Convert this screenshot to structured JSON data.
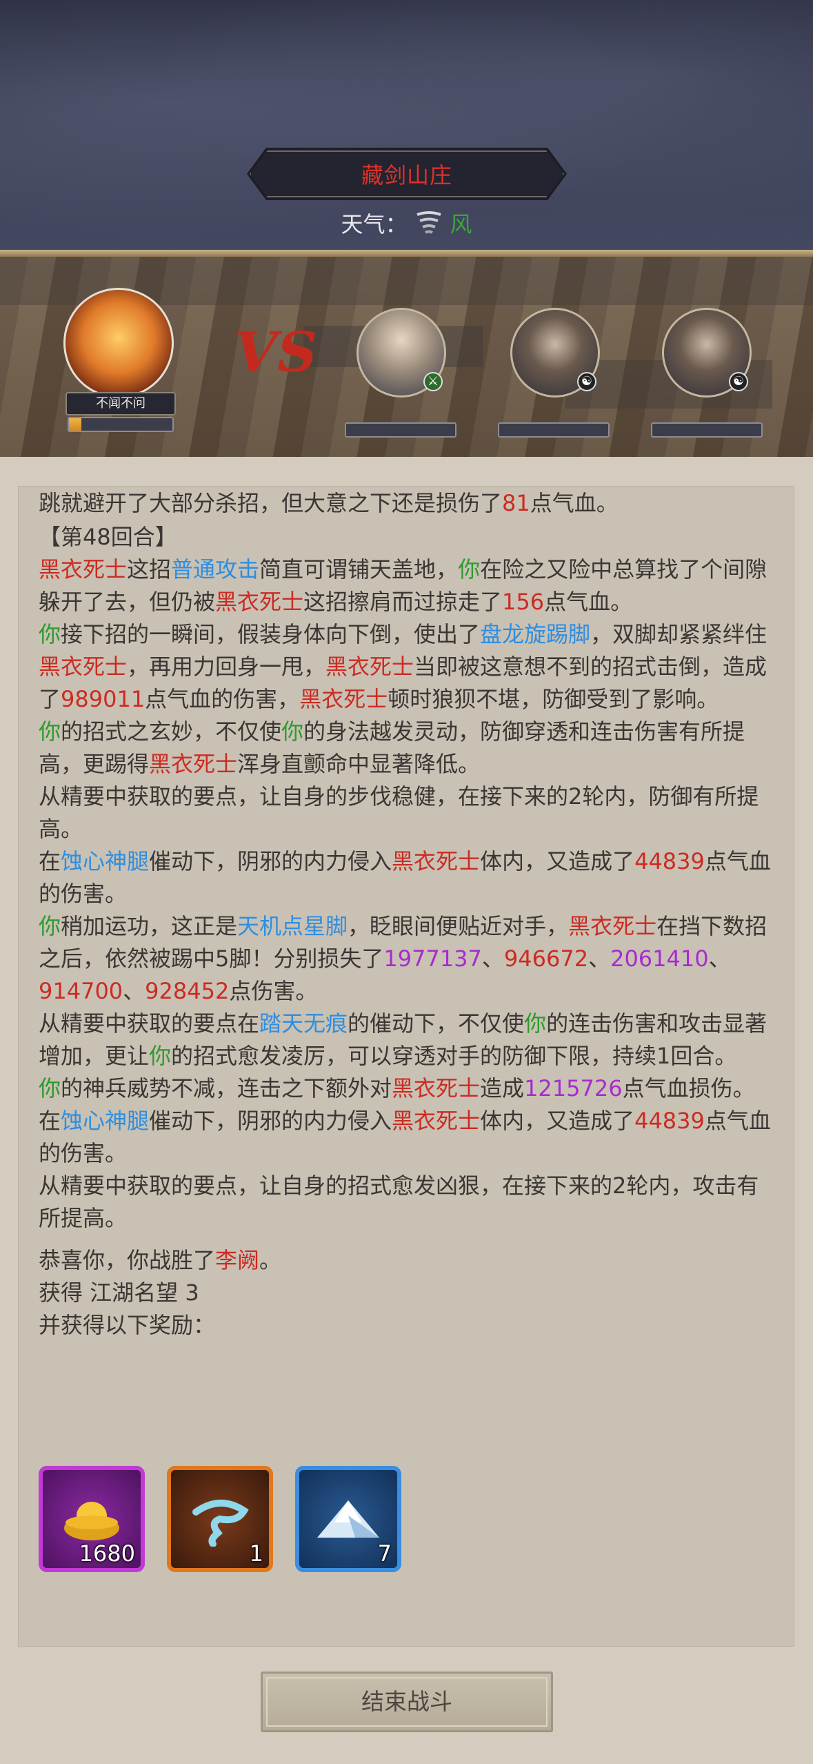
{
  "header": {
    "location": "藏剑山庄",
    "weather_label": "天气：",
    "weather_icon": "whirlwind-icon",
    "weather_value": "风"
  },
  "battle": {
    "player": {
      "name": "不闻不问",
      "hp_fraction": 0.12
    },
    "vs_text": "VS",
    "enemies": [
      {
        "icon": "swordsman-portrait",
        "badge": "sword"
      },
      {
        "icon": "masked-assassin-portrait",
        "badge": "yin-yang"
      },
      {
        "icon": "masked-assassin-portrait",
        "badge": "yin-yang"
      }
    ]
  },
  "log": {
    "l1": [
      "跳就避开了大部分杀招，但大意之下还是损伤了",
      "81",
      "点气血。"
    ],
    "round": "【第48回合】",
    "l2": [
      "黑衣死士",
      "这招",
      "普通攻击",
      "简直可谓铺天盖地，",
      "你",
      "在险之又险中总算找了个间隙躲开了去，但仍被",
      "黑衣死士",
      "这招擦肩而过掠走了",
      "156",
      "点气血。"
    ],
    "l3": [
      "你",
      "接下招的一瞬间，假装身体向下倒，使出了",
      "盘龙旋踢脚",
      "，双脚却紧紧绊住",
      "黑衣死士",
      "，再用力回身一甩，",
      "黑衣死士",
      "当即被这意想不到的招式击倒，造成了",
      "989011",
      "点气血的伤害，",
      "黑衣死士",
      "顿时狼狈不堪，防御受到了影响。"
    ],
    "l4": [
      "你",
      "的招式之玄妙，不仅使",
      "你",
      "的身法越发灵动，防御穿透和连击伤害有所提高，更踢得",
      "黑衣死士",
      "浑身直颤命中显著降低。"
    ],
    "l5": "从精要中获取的要点，让自身的步伐稳健，在接下来的2轮内，防御有所提高。",
    "l6": [
      "在",
      "蚀心神腿",
      "催动下，阴邪的内力侵入",
      "黑衣死士",
      "体内，又造成了",
      "44839",
      "点气血的伤害。"
    ],
    "l7": [
      "你",
      "稍加运功，这正是",
      "天机点星脚",
      "，眨眼间便贴近对手，",
      "黑衣死士",
      "在挡下数招之后，依然被踢中5脚！分别损失了",
      "1977137",
      "、",
      "946672",
      "、",
      "2061410",
      "、",
      "914700",
      "、",
      "928452",
      "点伤害。"
    ],
    "l8": [
      "从精要中获取的要点在",
      "踏天无痕",
      "的催动下，不仅使",
      "你",
      "的连击伤害和攻击显著增加，更让",
      "你",
      "的招式愈发凌厉，可以穿透对手的防御下限，持续1回合。"
    ],
    "l9": [
      "你",
      "的神兵威势不减，连击之下额外对",
      "黑衣死士",
      "造成",
      "1215726",
      "点气血损伤。"
    ],
    "l10": [
      "在",
      "蚀心神腿",
      "催动下，阴邪的内力侵入",
      "黑衣死士",
      "体内，又造成了",
      "44839",
      "点气血的伤害。"
    ],
    "l11": "从精要中获取的要点，让自身的招式愈发凶狠，在接下来的2轮内，攻击有所提高。",
    "victory": [
      "恭喜你，你战胜了",
      "李阙",
      "。"
    ],
    "fame": "获得 江湖名望 3",
    "rewards_label": "并获得以下奖励："
  },
  "rewards": [
    {
      "icon": "gold-ingot-icon",
      "count": "1680",
      "border": "#c13ad6"
    },
    {
      "icon": "blue-cloud-icon",
      "count": "1",
      "border": "#e0781c"
    },
    {
      "icon": "snow-mountain-icon",
      "count": "7",
      "border": "#3a8ee0"
    }
  ],
  "end_button": "结束战斗"
}
